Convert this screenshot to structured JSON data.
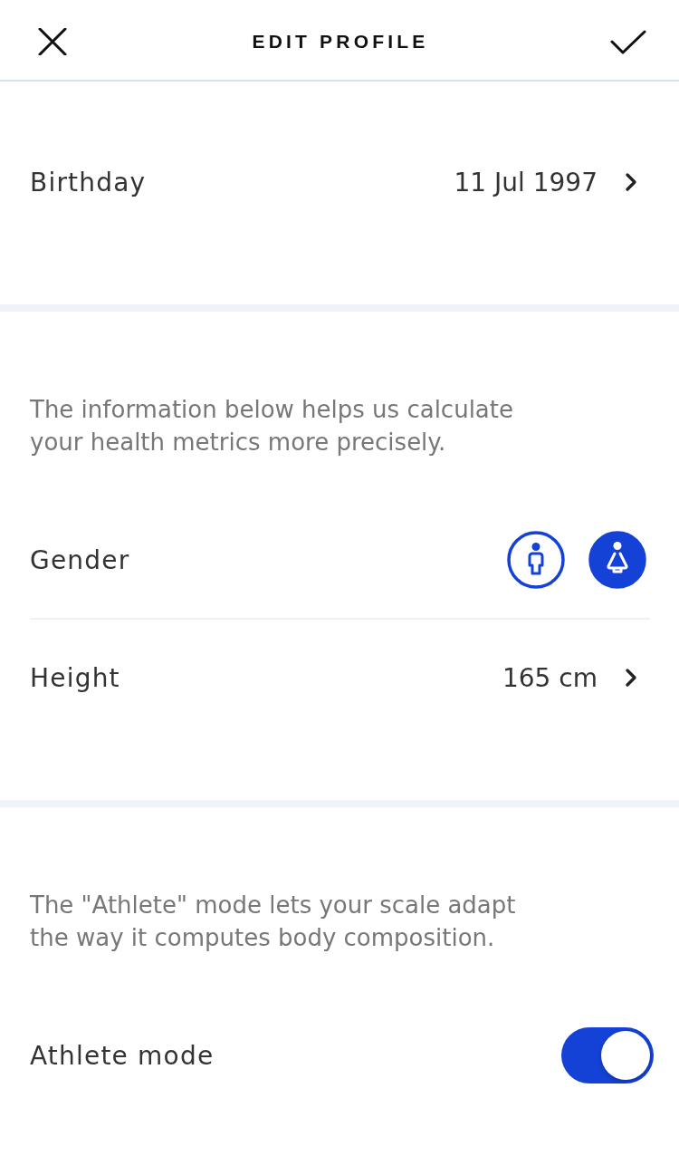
{
  "header": {
    "title": "EDIT PROFILE"
  },
  "sections": [
    {
      "rows": [
        {
          "kind": "value",
          "label": "Birthday",
          "value": "11 Jul 1997"
        }
      ]
    },
    {
      "note": "The information below helps us calculate your health metrics more precisely.",
      "rows": [
        {
          "kind": "gender",
          "label": "Gender",
          "options": [
            {
              "kind": "male",
              "selected": false
            },
            {
              "kind": "female",
              "selected": true
            }
          ]
        },
        {
          "kind": "value",
          "label": "Height",
          "value": "165 cm"
        }
      ]
    },
    {
      "note": "The \"Athlete\" mode lets your scale adapt the way it computes body composition.",
      "rows": [
        {
          "kind": "toggle",
          "label": "Athlete mode",
          "on": true
        }
      ]
    }
  ]
}
